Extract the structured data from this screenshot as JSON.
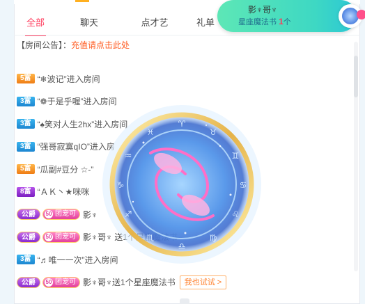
{
  "tabs": [
    {
      "label": "全部",
      "active": true
    },
    {
      "label": "聊天",
      "active": false
    },
    {
      "label": "点才艺",
      "active": false
    },
    {
      "label": "礼单",
      "active": false
    }
  ],
  "notice": {
    "prefix": "【房间公告】：",
    "link_text": "充值请点击此处"
  },
  "messages": [
    {
      "badge": "5富",
      "badge_color": "orange",
      "text": "“❄波记”进入房间"
    },
    {
      "badge": "3富",
      "badge_color": "blue",
      "text": "“❁于是乎喔”进入房间"
    },
    {
      "badge": "3富",
      "badge_color": "blue",
      "text": "“♠笑对人生2hx”进入房间"
    },
    {
      "badge": "3富",
      "badge_color": "blue",
      "text": "“强哥寂寞qIO”进入房"
    },
    {
      "badge": "5富",
      "badge_color": "orange",
      "text": "“瓜副#豆分 ☆-”"
    },
    {
      "badge": "8富",
      "badge_color": "purple",
      "text": "“ＡＫ丶★咪咪"
    },
    {
      "guild": "公爵",
      "pet": "团宠可",
      "pet_level": "50",
      "text": "影♆"
    },
    {
      "guild": "公爵",
      "pet": "团宠可",
      "pet_level": "50",
      "text": "影♆哥♆ 送1个星座魔法书"
    },
    {
      "badge": "3富",
      "badge_color": "blue",
      "text": "“♬唯一一次”进入房间"
    },
    {
      "guild": "公爵",
      "pet": "团宠可",
      "pet_level": "50",
      "user": "影♆哥♆",
      "text": " 送1个星座魔法书",
      "button": "我也试试 >"
    }
  ],
  "gift_popup": {
    "sender": "影♆哥♆",
    "gift_name": "星座魔法书",
    "count": "1",
    "unit": "个"
  },
  "colors": {
    "accent": "#ff3b5c",
    "link": "#ff5a1f",
    "popup_green": "#3ed8c3"
  },
  "icons": {
    "medallion": "pisces-zodiac-medallion",
    "gift_thumb": "magic-book-icon"
  }
}
